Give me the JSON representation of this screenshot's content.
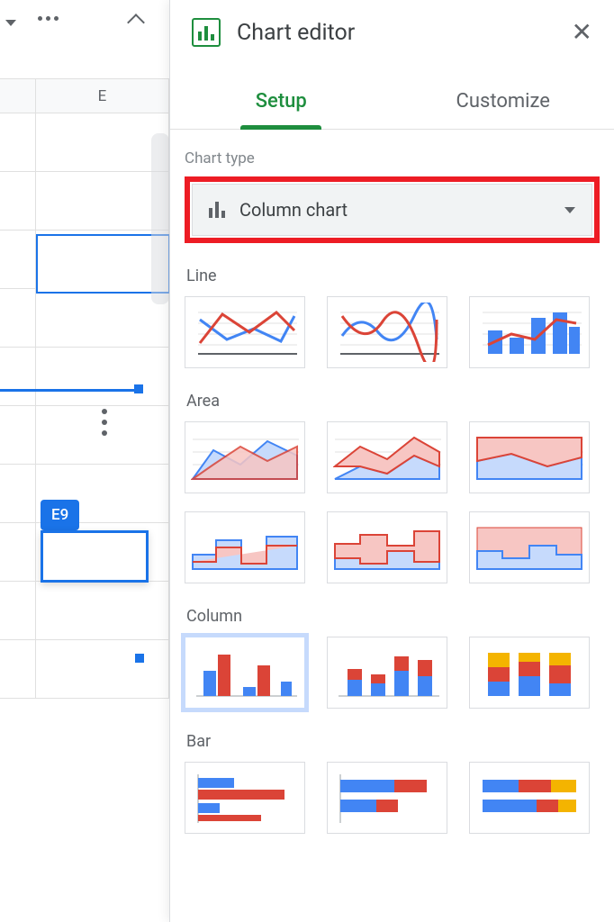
{
  "sheet": {
    "col_label": "E",
    "ref_chip": "E9"
  },
  "panel": {
    "title": "Chart editor",
    "tabs": {
      "setup": "Setup",
      "customize": "Customize"
    },
    "chart_type_label": "Chart type",
    "selected_type": "Column chart",
    "categories": {
      "line": "Line",
      "area": "Area",
      "column": "Column",
      "bar": "Bar"
    }
  }
}
